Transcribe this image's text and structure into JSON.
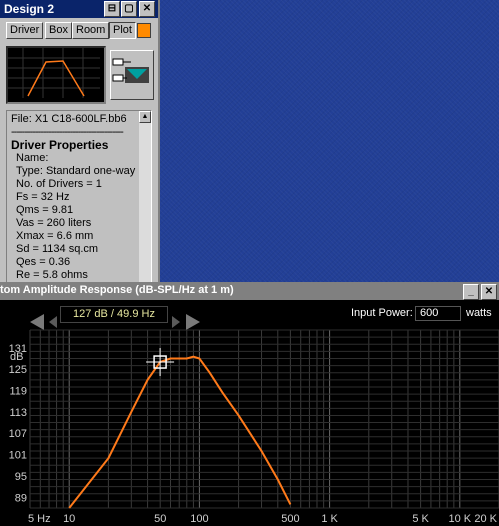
{
  "design_window": {
    "title": "Design 2",
    "title_buttons": [
      "⊟",
      "▢",
      "✕"
    ],
    "tabs": [
      "Driver",
      "Box",
      "Room",
      "Plot"
    ],
    "active_tab": "Plot",
    "swatch_color": "#ff8a00",
    "file_line": "File: X1 C18-600LF.bb6",
    "separator": "------------------------------------------",
    "section_title": "Driver Properties",
    "properties": [
      "Name:",
      "Type: Standard one-way",
      "No. of Drivers = 1",
      "Fs = 32 Hz",
      "Qms = 9.81",
      "Vas = 260 liters",
      "Xmax = 6.6 mm",
      "Sd = 1134 sq.cm",
      "Qes = 0.36",
      "Re = 5.8 ohms"
    ]
  },
  "response_window": {
    "title": "tom Amplitude Response (dB-SPL/Hz at 1 m)",
    "cursor_readout": "127 dB / 49.9 Hz",
    "input_power_label": "Input Power:",
    "input_power_value": "600",
    "input_power_unit": "watts",
    "y_unit": "dB",
    "y_ticks": [
      "131",
      "125",
      "119",
      "113",
      "107",
      "101",
      "95",
      "89"
    ],
    "x_ticks": [
      "5 Hz",
      "10",
      "50",
      "100",
      "500",
      "1 K",
      "5 K",
      "10 K",
      "20 K"
    ],
    "curve_color": "#ff7a1a"
  },
  "chart_data": {
    "type": "line",
    "title": "tom Amplitude Response (dB-SPL/Hz at 1 m)",
    "xlabel": "",
    "ylabel": "dB",
    "x_scale": "log",
    "xlim": [
      5,
      20000
    ],
    "ylim": [
      86,
      136
    ],
    "grid": true,
    "series": [
      {
        "x": [
          10,
          20,
          30,
          40,
          49.9,
          60,
          70,
          80,
          90,
          100,
          120,
          150,
          200,
          300,
          400,
          500
        ],
        "y": [
          86,
          100,
          113,
          122,
          127,
          128,
          128,
          128,
          128.5,
          128,
          124,
          118.5,
          112,
          102,
          94,
          87
        ],
        "color": "#ff7a1a"
      }
    ],
    "cursor": {
      "x": 49.9,
      "y": 127
    }
  }
}
